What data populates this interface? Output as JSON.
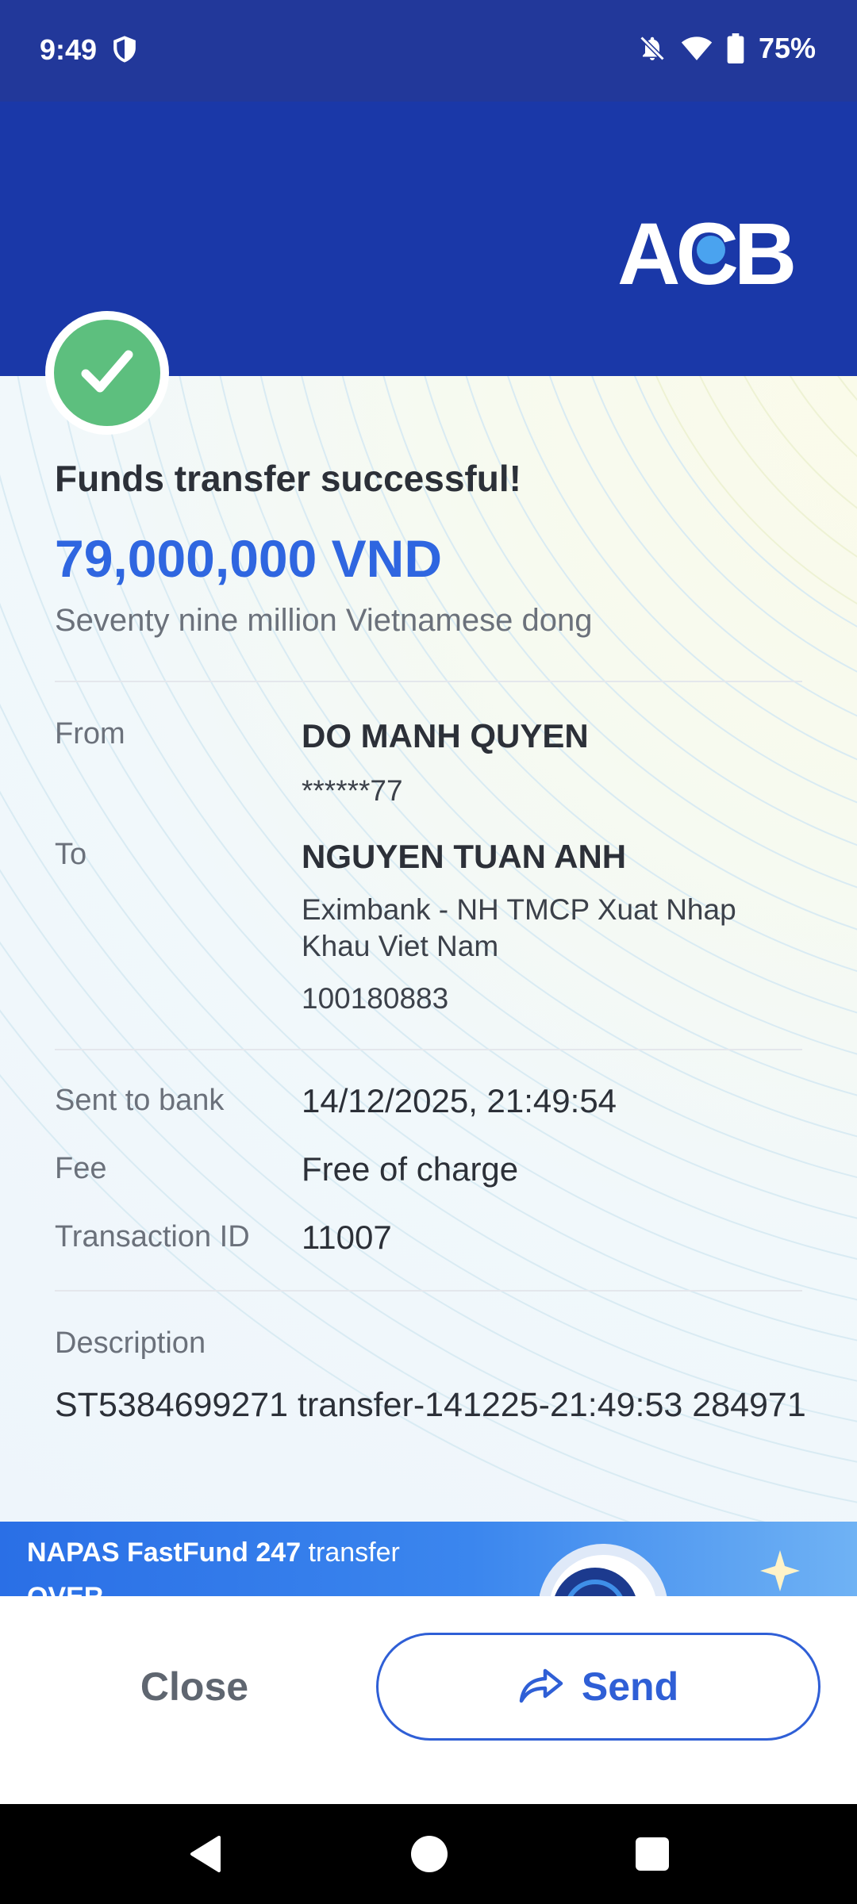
{
  "status_bar": {
    "time": "9:49",
    "battery": "75%"
  },
  "header": {
    "logo_text": "ACB",
    "brand_color": "#1a38a8"
  },
  "receipt": {
    "title": "Funds transfer successful!",
    "amount": "79,000,000 VND",
    "amount_words": "Seventy nine million Vietnamese dong",
    "from": {
      "label": "From",
      "name": "DO MANH QUYEN",
      "account": "******77"
    },
    "to": {
      "label": "To",
      "name": "NGUYEN TUAN ANH",
      "bank": "Eximbank - NH TMCP Xuat Nhap Khau Viet Nam",
      "account": "100180883"
    },
    "sent_to_bank": {
      "label": "Sent to bank",
      "value": "14/12/2025, 21:49:54"
    },
    "fee": {
      "label": "Fee",
      "value": "Free of charge"
    },
    "transaction_id": {
      "label": "Transaction ID",
      "value": "11007"
    },
    "description": {
      "label": "Description",
      "value": "ST5384699271 transfer-141225-21:49:53 284971"
    }
  },
  "promo": {
    "bold_text": "NAPAS FastFund 247",
    "text": " transfer",
    "line2": "OVER"
  },
  "actions": {
    "close_label": "Close",
    "send_label": "Send"
  },
  "colors": {
    "accent": "#2f66e0",
    "success": "#5dbf7e"
  }
}
